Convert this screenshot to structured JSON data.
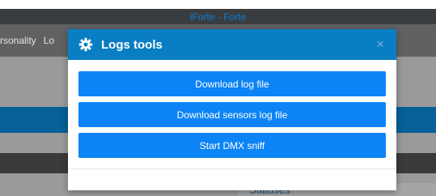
{
  "app": {
    "title": "iForte - Forte"
  },
  "nav": {
    "items": [
      "rsonality",
      "Lo"
    ]
  },
  "background": {
    "card_title": "Statuses"
  },
  "modal": {
    "title": "Logs tools",
    "header_icon": "gear-icon",
    "close_symbol": "×",
    "buttons": [
      "Download log file",
      "Download sensors log file",
      "Start DMX sniff"
    ]
  },
  "colors": {
    "header_bg": "#0a7ec2",
    "button_bg": "#0d84f5",
    "title_bar_bg": "#3a3d40",
    "title_text": "#0a7bd0"
  }
}
